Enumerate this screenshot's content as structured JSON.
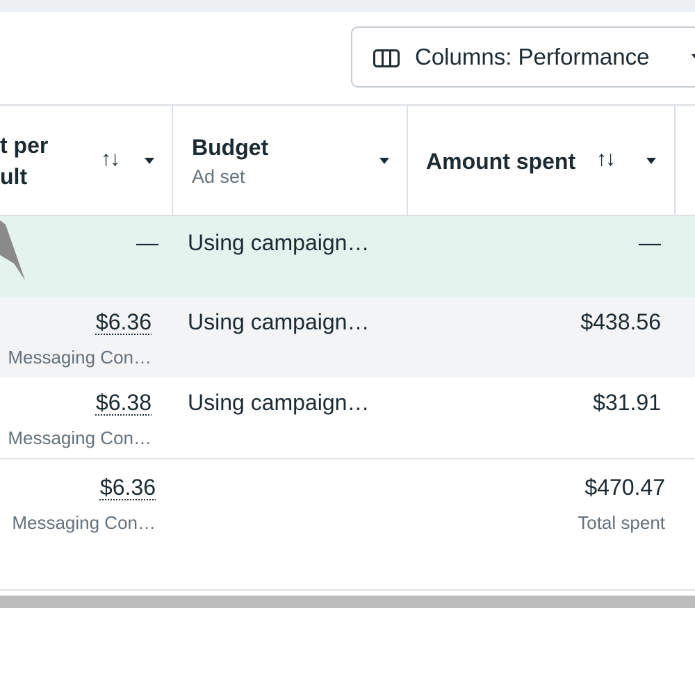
{
  "toolbar": {
    "columns_label": "Columns: Performance",
    "columns_icon": "columns-icon"
  },
  "table": {
    "headers": {
      "cost_per_result": {
        "line1": "t per",
        "line2": "ult",
        "sort_icon": "↑↓"
      },
      "budget": {
        "title": "Budget",
        "subtitle": "Ad set"
      },
      "amount_spent": {
        "title": "Amount spent",
        "sort_icon": "↑↓"
      }
    },
    "rows": [
      {
        "cost": "—",
        "cost_sub": "",
        "budget": "Using campaign…",
        "spent": "—",
        "spent_sub": ""
      },
      {
        "cost": "$6.36",
        "cost_sub": "Messaging Con…",
        "budget": "Using campaign…",
        "spent": "$438.56",
        "spent_sub": ""
      },
      {
        "cost": "$6.38",
        "cost_sub": "Messaging Con…",
        "budget": "Using campaign…",
        "spent": "$31.91",
        "spent_sub": ""
      }
    ],
    "totals": {
      "cost": "$6.36",
      "cost_sub": "Messaging Con…",
      "spent": "$470.47",
      "spent_sub": "Total spent"
    }
  },
  "colors": {
    "selected_row": "#e5f3ee",
    "hover_row": "#f3f4f6",
    "border": "#dde1e5",
    "muted_text": "#65717c"
  }
}
